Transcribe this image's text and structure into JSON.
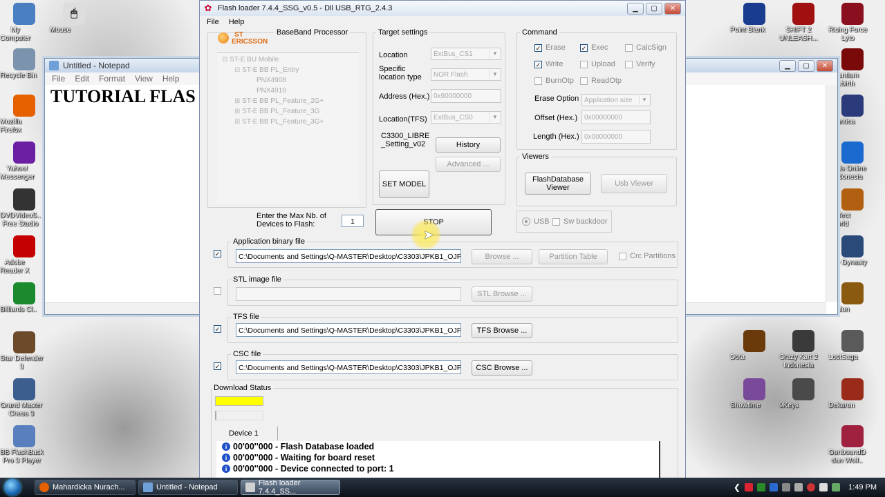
{
  "desktop": {
    "left_icons": [
      {
        "label": "My\nComputer",
        "icon": "computer-icon",
        "color": "#4a7fc1"
      },
      {
        "label": "Recycle Bin",
        "icon": "recycle-bin-icon",
        "color": "#7b93ad"
      },
      {
        "label": "Mozilla\nFirefox",
        "icon": "firefox-icon",
        "color": "#e66000"
      },
      {
        "label": "Yahoo!\nMessenger",
        "icon": "yahoo-messenger-icon",
        "color": "#6b1fa3"
      },
      {
        "label": "DVDVideoS..\nFree Studio",
        "icon": "dvdvideosoft-icon",
        "color": "#333333"
      },
      {
        "label": "Adobe\nReader X",
        "icon": "adobe-reader-icon",
        "color": "#c40000"
      },
      {
        "label": "Billiards Cl..",
        "icon": "billiards-icon",
        "color": "#1b8a2e"
      },
      {
        "label": "Star Defender\n3",
        "icon": "star-defender-icon",
        "color": "#6d4a2a"
      },
      {
        "label": "Grand Master\nChess 3",
        "icon": "chess-icon",
        "color": "#3b5e8f"
      },
      {
        "label": "BB FlashBack\nPro 3 Player",
        "icon": "flashback-icon",
        "color": "#5a7fbf"
      }
    ],
    "mouse_icon_label": "Mouse",
    "right_icons": [
      {
        "label": "Point Blank",
        "icon": "point-blank-icon",
        "color": "#1a3c8f"
      },
      {
        "label": "SHIFT 2\nUNLEASH...",
        "icon": "shift2-icon",
        "color": "#a01010"
      },
      {
        "label": "Rising Force\nLyto",
        "icon": "rising-force-icon",
        "color": "#8a1020"
      },
      {
        "label": "Bizantium\nRebirth",
        "icon": "bizantium-icon",
        "color": "#7a0a0a"
      },
      {
        "label": "Atlantica",
        "icon": "atlantica-icon",
        "color": "#2a3a7a"
      },
      {
        "label": "Nods Online\nIndonesia",
        "icon": "nods-online-icon",
        "color": "#1a6ad0"
      },
      {
        "label": "Perfect\nWorld",
        "icon": "perfect-world-icon",
        "color": "#b06010"
      },
      {
        "label": "3de Dynasty",
        "icon": "dynasty-icon",
        "color": "#2a4a7a"
      },
      {
        "label": "Avalon",
        "icon": "avalon-icon",
        "color": "#8a5a10"
      },
      {
        "label": "Dota",
        "icon": "dota-icon",
        "color": "#6a3a0a"
      },
      {
        "label": "Crazy Kart 2\nIndonesia",
        "icon": "crazy-kart-icon",
        "color": "#3a3a3a"
      },
      {
        "label": "LostSaga",
        "icon": "lostsaga-icon",
        "color": "#5a5a5a"
      },
      {
        "label": "Showtime",
        "icon": "showtime-icon",
        "color": "#7a4a9a"
      },
      {
        "label": "9Keys",
        "icon": "9keys-icon",
        "color": "#4a4a4a"
      },
      {
        "label": "Dekaron",
        "icon": "dekaron-icon",
        "color": "#9a2a1a"
      },
      {
        "label": "GunboundD\ndan Wolf..",
        "icon": "gunbound-icon",
        "color": "#a02040"
      }
    ]
  },
  "notepad": {
    "title": "Untitled - Notepad",
    "menu": [
      "File",
      "Edit",
      "Format",
      "View",
      "Help"
    ],
    "content": "TUTORIAL FLAS"
  },
  "flash": {
    "title": "Flash loader 7.4.4_SSG_v0.5 - Dll USB_RTG_2.4.3",
    "menu": [
      "File",
      "Help"
    ],
    "logo_line1": "ST",
    "logo_line2": "ERICSSON",
    "baseband": {
      "legend": "BaseBand Processor",
      "tree": [
        "ST-E BU Mobile",
        "ST-E BB PL_Entry",
        "PNX4908",
        "PNX4910",
        "ST-E BB PL_Feature_2G+",
        "ST-E BB PL_Feature_3G",
        "ST-E BB PL_Feature_3G+"
      ]
    },
    "target": {
      "legend": "Target settings",
      "location_label": "Location",
      "location_value": "ExtBus_CS1",
      "spec_label": "Specific\nlocation type",
      "spec_value": "NOR Flash",
      "address_label": "Address (Hex.)",
      "address_value": "0x90000000",
      "locationtfs_label": "Location(TFS)",
      "locationtfs_value": "ExtBus_CS0",
      "model_text": "C3300_LIBRE\n_Setting_v02",
      "history_btn": "History",
      "advanced_btn": "Advanced ...",
      "setmodel_btn": "SET MODEL"
    },
    "command": {
      "legend": "Command",
      "checks": [
        {
          "label": "Erase",
          "checked": true
        },
        {
          "label": "Exec",
          "checked": true
        },
        {
          "label": "CalcSign",
          "checked": false
        },
        {
          "label": "Write",
          "checked": true
        },
        {
          "label": "Upload",
          "checked": false
        },
        {
          "label": "Verify",
          "checked": false
        },
        {
          "label": "BurnOtp",
          "checked": false
        },
        {
          "label": "ReadOtp",
          "checked": false
        }
      ],
      "erase_option_label": "Erase Option",
      "erase_option_value": "Application size",
      "offset_label": "Offset (Hex.)",
      "offset_value": "0x00000000",
      "length_label": "Length (Hex.)",
      "length_value": "0x00000000"
    },
    "viewers": {
      "legend": "Viewers",
      "flashdb_btn": "FlashDatabase\nViewer",
      "usb_btn": "Usb Viewer"
    },
    "devices_label": "Enter the Max Nb. of\nDevices to Flash:",
    "devices_value": "1",
    "stop_btn": "STOP",
    "usb_radio": "USB",
    "sw_backdoor": "Sw backdoor",
    "files": {
      "app": {
        "label": "Application binary file",
        "path": "C:\\Documents and Settings\\Q-MASTER\\Desktop\\C3303\\JPKB1_OJPK",
        "browse": "Browse ...",
        "partition": "Partition Table",
        "crc": "Crc Partitions"
      },
      "stl": {
        "label": "STL image file",
        "path": "",
        "browse": "STL Browse ..."
      },
      "tfs": {
        "label": "TFS file",
        "path": "C:\\Documents and Settings\\Q-MASTER\\Desktop\\C3303\\JPKB1_OJPK",
        "browse": "TFS Browse ..."
      },
      "csc": {
        "label": "CSC file",
        "path": "C:\\Documents and Settings\\Q-MASTER\\Desktop\\C3303\\JPKB1_OJPK",
        "browse": "CSC Browse ..."
      }
    },
    "download_status_label": "Download Status",
    "progress_color": "#ffff00",
    "device_tab": "Device 1",
    "log": [
      "00'00''000 - Flash Database loaded",
      "00'00''000 - Waiting for board reset",
      "00'00''000 - Device connected to port: 1"
    ]
  },
  "taskbar": {
    "tasks": [
      {
        "label": "Mahardicka Nurach...",
        "icon": "firefox-icon",
        "color": "#e66000"
      },
      {
        "label": "Untitled - Notepad",
        "icon": "notepad-icon",
        "color": "#6fa0d8"
      },
      {
        "label": "Flash loader 7.4.4_SS...",
        "icon": "flash-loader-icon",
        "color": "#d0d0d0"
      }
    ],
    "clock": "1:49 PM"
  }
}
